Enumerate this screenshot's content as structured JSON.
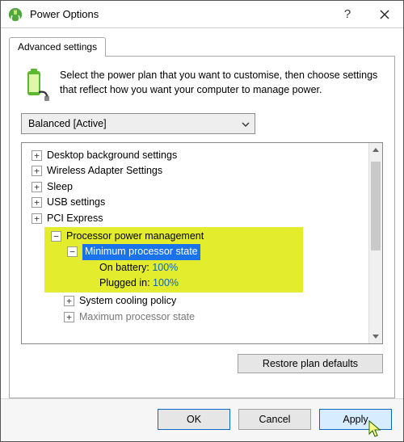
{
  "window": {
    "title": "Power Options"
  },
  "tabs": {
    "advanced": "Advanced settings"
  },
  "intro": "Select the power plan that you want to customise, then choose settings that reflect how you want your computer to manage power.",
  "plan": {
    "selected": "Balanced [Active]"
  },
  "tree": {
    "desktop_bg": "Desktop background settings",
    "wireless": "Wireless Adapter Settings",
    "sleep": "Sleep",
    "usb": "USB settings",
    "pci": "PCI Express",
    "proc_mgmt": "Processor power management",
    "min_state": "Minimum processor state",
    "on_battery_label": "On battery:",
    "on_battery_value": "100%",
    "plugged_label": "Plugged in:",
    "plugged_value": "100%",
    "cooling": "System cooling policy",
    "max_state": "Maximum processor state"
  },
  "buttons": {
    "restore": "Restore plan defaults",
    "ok": "OK",
    "cancel": "Cancel",
    "apply": "Apply"
  }
}
